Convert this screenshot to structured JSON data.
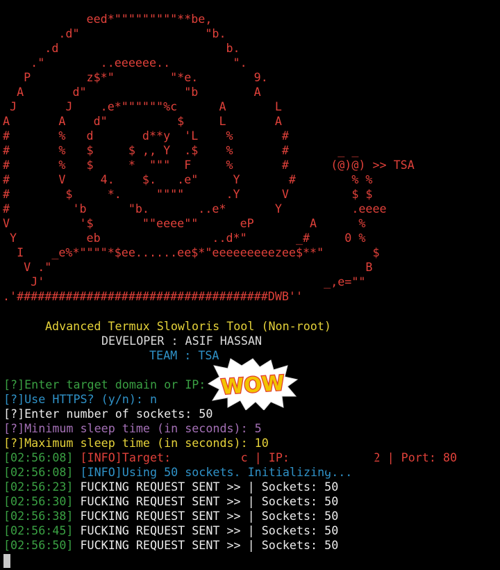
{
  "banner": {
    "art_color": "#e0413a",
    "art_lines": [
      "            eed*\"\"\"\"\"\"\"\"\"**be,",
      "        .d\"                  \"b.",
      "      .d                        b.",
      "    .\"        ..eeeeee..         \".",
      "   P        z$*\"        \"*e.        9.",
      "  A       d\"              \"b        A",
      " J       J    .e*\"\"\"\"\"\"%c      A       L",
      "A       A    d\"          $     L       A",
      "#       %   d       d**y  'L    %       #",
      "#       %   $     $ ,, Y  .$    %       #       _ _",
      "#       %   $     *  \"\"\"  F     %       #      (@)@) >> TSA",
      "#       V     4.    $.   .e\"     Y       #        % %",
      "#        $     *.     \"\"\"\"      .Y      V         $ $",
      "#         'b      \"b.       ..e*       Y          .eeee",
      "V          '$       \"\"eeee\"\"      eP        A      %",
      " Y          eb                ..d*\"       _#     0 %",
      "  I    _e%*\"\"\"\"*$ee......ee$*\"eeeeeeeeezee$**\"       $",
      "   V .\"                                             B",
      "    J'                                        _,e=\"\"",
      ".'####################################DWB''"
    ],
    "title": "Advanced Termux Slowloris Tool (Non-root)",
    "title_color": "#e6d33a",
    "developer": "DEVELOPER : ASIF HASSAN",
    "developer_color": "#dcdcdc",
    "team": "TEAM : TSA",
    "team_color": "#2f92c8"
  },
  "sticker": {
    "text": "WOW"
  },
  "prompts": [
    {
      "text": "[?]Enter target domain or IP:",
      "color": "#3aa043"
    },
    {
      "text": "[?]Use HTTPS? (y/n): n",
      "color": "#2f92c8"
    },
    {
      "text": "[?]Enter number of sockets: 50",
      "color": "#ececec"
    },
    {
      "text": "[?]Minimum sleep time (in seconds): 5",
      "color": "#a470b6"
    },
    {
      "text": "[?]Maximum sleep time (in seconds): 10",
      "color": "#e6d33a"
    }
  ],
  "logs": [
    {
      "time": "[02:56:08]",
      "message": "[INFO]Target:          c | IP:          .02 | Port: 80",
      "time_color": "#3aa043",
      "message_color": "#e0413a"
    },
    {
      "time": "[02:56:08]",
      "message": "[INFO]Using 50 sockets. Initializing...",
      "time_color": "#3aa043",
      "message_color": "#2f92c8"
    },
    {
      "time": "[02:56:23]",
      "message": "FUCKING REQUEST SENT >> | Sockets: 50",
      "time_color": "#3aa043",
      "message_color": "#ececec"
    },
    {
      "time": "[02:56:30]",
      "message": "FUCKING REQUEST SENT >> | Sockets: 50",
      "time_color": "#3aa043",
      "message_color": "#ececec"
    },
    {
      "time": "[02:56:38]",
      "message": "FUCKING REQUEST SENT >> | Sockets: 50",
      "time_color": "#3aa043",
      "message_color": "#ececec"
    },
    {
      "time": "[02:56:45]",
      "message": "FUCKING REQUEST SENT >> | Sockets: 50",
      "time_color": "#3aa043",
      "message_color": "#ececec"
    },
    {
      "time": "[02:56:50]",
      "message": "FUCKING REQUEST SENT >> | Sockets: 50",
      "time_color": "#3aa043",
      "message_color": "#ececec"
    }
  ],
  "cursor_color": "#c8c8c8"
}
